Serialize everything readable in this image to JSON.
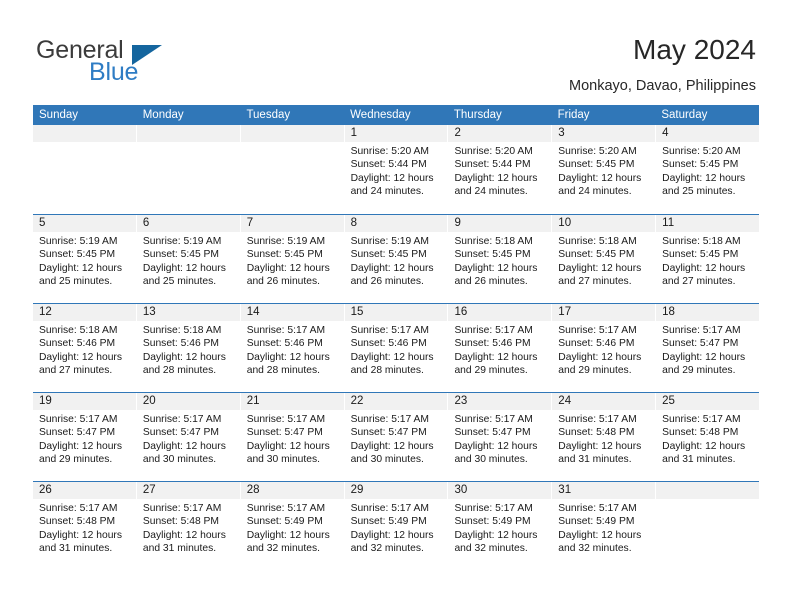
{
  "logo": {
    "word_one": "General",
    "word_two": "Blue",
    "triangle_color": "#14659e",
    "blue_text_color": "#2e7cc4"
  },
  "header": {
    "title": "May 2024",
    "location": "Monkayo, Davao, Philippines"
  },
  "theme": {
    "header_blue": "#3077b8",
    "daynum_band": "#f1f1f1",
    "text": "#1a1a1a"
  },
  "weekdays": [
    "Sunday",
    "Monday",
    "Tuesday",
    "Wednesday",
    "Thursday",
    "Friday",
    "Saturday"
  ],
  "labels": {
    "sunrise_prefix": "Sunrise:",
    "sunset_prefix": "Sunset:",
    "daylight_prefix": "Daylight:"
  },
  "weeks": [
    [
      {
        "day": "",
        "empty": true
      },
      {
        "day": "",
        "empty": true
      },
      {
        "day": "",
        "empty": true
      },
      {
        "day": "1",
        "sunrise": "Sunrise: 5:20 AM",
        "sunset": "Sunset: 5:44 PM",
        "daylight_1": "Daylight: 12 hours",
        "daylight_2": "and 24 minutes."
      },
      {
        "day": "2",
        "sunrise": "Sunrise: 5:20 AM",
        "sunset": "Sunset: 5:44 PM",
        "daylight_1": "Daylight: 12 hours",
        "daylight_2": "and 24 minutes."
      },
      {
        "day": "3",
        "sunrise": "Sunrise: 5:20 AM",
        "sunset": "Sunset: 5:45 PM",
        "daylight_1": "Daylight: 12 hours",
        "daylight_2": "and 24 minutes."
      },
      {
        "day": "4",
        "sunrise": "Sunrise: 5:20 AM",
        "sunset": "Sunset: 5:45 PM",
        "daylight_1": "Daylight: 12 hours",
        "daylight_2": "and 25 minutes."
      }
    ],
    [
      {
        "day": "5",
        "sunrise": "Sunrise: 5:19 AM",
        "sunset": "Sunset: 5:45 PM",
        "daylight_1": "Daylight: 12 hours",
        "daylight_2": "and 25 minutes."
      },
      {
        "day": "6",
        "sunrise": "Sunrise: 5:19 AM",
        "sunset": "Sunset: 5:45 PM",
        "daylight_1": "Daylight: 12 hours",
        "daylight_2": "and 25 minutes."
      },
      {
        "day": "7",
        "sunrise": "Sunrise: 5:19 AM",
        "sunset": "Sunset: 5:45 PM",
        "daylight_1": "Daylight: 12 hours",
        "daylight_2": "and 26 minutes."
      },
      {
        "day": "8",
        "sunrise": "Sunrise: 5:19 AM",
        "sunset": "Sunset: 5:45 PM",
        "daylight_1": "Daylight: 12 hours",
        "daylight_2": "and 26 minutes."
      },
      {
        "day": "9",
        "sunrise": "Sunrise: 5:18 AM",
        "sunset": "Sunset: 5:45 PM",
        "daylight_1": "Daylight: 12 hours",
        "daylight_2": "and 26 minutes."
      },
      {
        "day": "10",
        "sunrise": "Sunrise: 5:18 AM",
        "sunset": "Sunset: 5:45 PM",
        "daylight_1": "Daylight: 12 hours",
        "daylight_2": "and 27 minutes."
      },
      {
        "day": "11",
        "sunrise": "Sunrise: 5:18 AM",
        "sunset": "Sunset: 5:45 PM",
        "daylight_1": "Daylight: 12 hours",
        "daylight_2": "and 27 minutes."
      }
    ],
    [
      {
        "day": "12",
        "sunrise": "Sunrise: 5:18 AM",
        "sunset": "Sunset: 5:46 PM",
        "daylight_1": "Daylight: 12 hours",
        "daylight_2": "and 27 minutes."
      },
      {
        "day": "13",
        "sunrise": "Sunrise: 5:18 AM",
        "sunset": "Sunset: 5:46 PM",
        "daylight_1": "Daylight: 12 hours",
        "daylight_2": "and 28 minutes."
      },
      {
        "day": "14",
        "sunrise": "Sunrise: 5:17 AM",
        "sunset": "Sunset: 5:46 PM",
        "daylight_1": "Daylight: 12 hours",
        "daylight_2": "and 28 minutes."
      },
      {
        "day": "15",
        "sunrise": "Sunrise: 5:17 AM",
        "sunset": "Sunset: 5:46 PM",
        "daylight_1": "Daylight: 12 hours",
        "daylight_2": "and 28 minutes."
      },
      {
        "day": "16",
        "sunrise": "Sunrise: 5:17 AM",
        "sunset": "Sunset: 5:46 PM",
        "daylight_1": "Daylight: 12 hours",
        "daylight_2": "and 29 minutes."
      },
      {
        "day": "17",
        "sunrise": "Sunrise: 5:17 AM",
        "sunset": "Sunset: 5:46 PM",
        "daylight_1": "Daylight: 12 hours",
        "daylight_2": "and 29 minutes."
      },
      {
        "day": "18",
        "sunrise": "Sunrise: 5:17 AM",
        "sunset": "Sunset: 5:47 PM",
        "daylight_1": "Daylight: 12 hours",
        "daylight_2": "and 29 minutes."
      }
    ],
    [
      {
        "day": "19",
        "sunrise": "Sunrise: 5:17 AM",
        "sunset": "Sunset: 5:47 PM",
        "daylight_1": "Daylight: 12 hours",
        "daylight_2": "and 29 minutes."
      },
      {
        "day": "20",
        "sunrise": "Sunrise: 5:17 AM",
        "sunset": "Sunset: 5:47 PM",
        "daylight_1": "Daylight: 12 hours",
        "daylight_2": "and 30 minutes."
      },
      {
        "day": "21",
        "sunrise": "Sunrise: 5:17 AM",
        "sunset": "Sunset: 5:47 PM",
        "daylight_1": "Daylight: 12 hours",
        "daylight_2": "and 30 minutes."
      },
      {
        "day": "22",
        "sunrise": "Sunrise: 5:17 AM",
        "sunset": "Sunset: 5:47 PM",
        "daylight_1": "Daylight: 12 hours",
        "daylight_2": "and 30 minutes."
      },
      {
        "day": "23",
        "sunrise": "Sunrise: 5:17 AM",
        "sunset": "Sunset: 5:47 PM",
        "daylight_1": "Daylight: 12 hours",
        "daylight_2": "and 30 minutes."
      },
      {
        "day": "24",
        "sunrise": "Sunrise: 5:17 AM",
        "sunset": "Sunset: 5:48 PM",
        "daylight_1": "Daylight: 12 hours",
        "daylight_2": "and 31 minutes."
      },
      {
        "day": "25",
        "sunrise": "Sunrise: 5:17 AM",
        "sunset": "Sunset: 5:48 PM",
        "daylight_1": "Daylight: 12 hours",
        "daylight_2": "and 31 minutes."
      }
    ],
    [
      {
        "day": "26",
        "sunrise": "Sunrise: 5:17 AM",
        "sunset": "Sunset: 5:48 PM",
        "daylight_1": "Daylight: 12 hours",
        "daylight_2": "and 31 minutes."
      },
      {
        "day": "27",
        "sunrise": "Sunrise: 5:17 AM",
        "sunset": "Sunset: 5:48 PM",
        "daylight_1": "Daylight: 12 hours",
        "daylight_2": "and 31 minutes."
      },
      {
        "day": "28",
        "sunrise": "Sunrise: 5:17 AM",
        "sunset": "Sunset: 5:49 PM",
        "daylight_1": "Daylight: 12 hours",
        "daylight_2": "and 32 minutes."
      },
      {
        "day": "29",
        "sunrise": "Sunrise: 5:17 AM",
        "sunset": "Sunset: 5:49 PM",
        "daylight_1": "Daylight: 12 hours",
        "daylight_2": "and 32 minutes."
      },
      {
        "day": "30",
        "sunrise": "Sunrise: 5:17 AM",
        "sunset": "Sunset: 5:49 PM",
        "daylight_1": "Daylight: 12 hours",
        "daylight_2": "and 32 minutes."
      },
      {
        "day": "31",
        "sunrise": "Sunrise: 5:17 AM",
        "sunset": "Sunset: 5:49 PM",
        "daylight_1": "Daylight: 12 hours",
        "daylight_2": "and 32 minutes."
      },
      {
        "day": "",
        "empty": true
      }
    ]
  ]
}
